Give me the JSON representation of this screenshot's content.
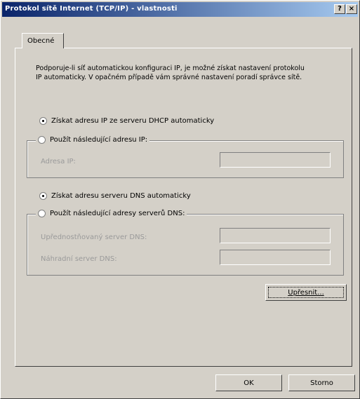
{
  "window": {
    "title": "Protokol sítě Internet (TCP/IP) - vlastnosti",
    "help_glyph": "?",
    "close_glyph": "×"
  },
  "tabs": [
    {
      "label": "Obecné"
    }
  ],
  "description": "Podporuje-li síť automatickou konfiguraci IP, je možné získat nastavení protokolu IP automaticky. V opačném případě vám správné nastavení poradí správce sítě.",
  "ip": {
    "auto_label": "Získat adresu IP ze serveru DHCP automaticky",
    "manual_label": "Použít následující adresu IP:",
    "address_label": "Adresa IP:",
    "address_value": "",
    "auto_selected": true
  },
  "dns": {
    "auto_label": "Získat adresu serveru DNS automaticky",
    "manual_label": "Použít následující adresy serverů DNS:",
    "preferred_label": "Upřednostňovaný server DNS:",
    "preferred_value": "",
    "alternate_label": "Náhradní server DNS:",
    "alternate_value": "",
    "auto_selected": true
  },
  "buttons": {
    "advanced": "Upřesnit...",
    "ok": "OK",
    "cancel": "Storno"
  },
  "colors": {
    "titlebar_start": "#0a246a",
    "titlebar_end": "#a6caf0",
    "face": "#d4d0c8"
  }
}
